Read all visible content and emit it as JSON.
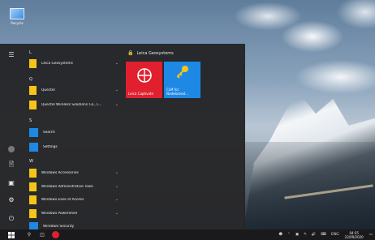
{
  "desktop": {
    "icon_label": "Recycle"
  },
  "start_menu": {
    "groups": [
      {
        "letter": "L",
        "apps": [
          {
            "name": "Leica Geosystems",
            "icon": "folder-icon",
            "expandable": true
          }
        ]
      },
      {
        "letter": "Q",
        "apps": [
          {
            "name": "Quectel",
            "icon": "folder-icon",
            "expandable": true
          },
          {
            "name": "Quectel Wireless Solutions Co., L...",
            "icon": "folder-icon",
            "expandable": true
          }
        ]
      },
      {
        "letter": "S",
        "apps": [
          {
            "name": "Search",
            "icon": "search-icon",
            "expandable": false
          },
          {
            "name": "Settings",
            "icon": "gear-icon",
            "expandable": false
          }
        ]
      },
      {
        "letter": "W",
        "apps": [
          {
            "name": "Windows Accessories",
            "icon": "folder-icon",
            "expandable": true
          },
          {
            "name": "Windows Administrative Tools",
            "icon": "folder-icon",
            "expandable": true
          },
          {
            "name": "Windows Ease of Access",
            "icon": "folder-icon",
            "expandable": true
          },
          {
            "name": "Windows PowerShell",
            "icon": "folder-icon",
            "expandable": true
          },
          {
            "name": "Windows Security",
            "icon": "shield-icon",
            "expandable": false
          }
        ]
      }
    ],
    "tiles_group": "Leica Geosystems",
    "tiles": [
      {
        "label": "Leica Captivate",
        "color": "#e0202e",
        "icon": "leica-captivate-icon"
      },
      {
        "label_line1": "CLM for",
        "label_line2": "Nodelocked...",
        "color": "#1e88e5",
        "icon": "key-icon"
      }
    ]
  },
  "taskbar": {
    "tray": {
      "language": "ENG",
      "time": "04:55",
      "date": "22/09/2020"
    }
  }
}
